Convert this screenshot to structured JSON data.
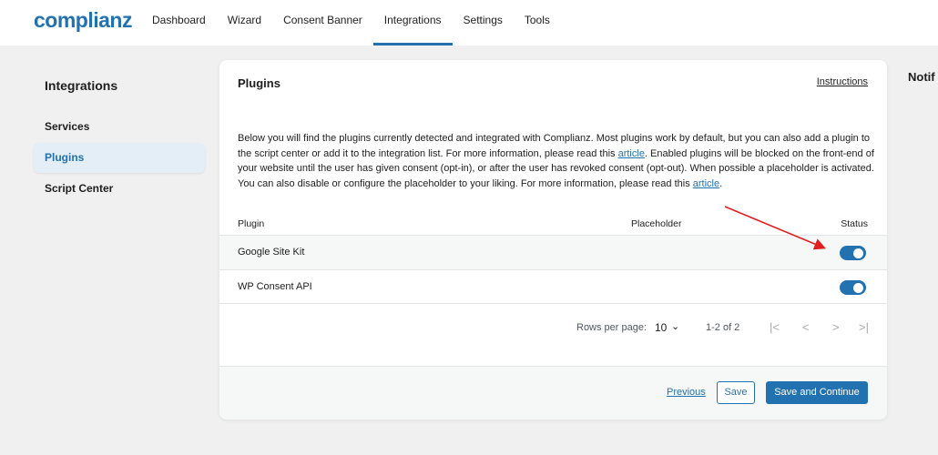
{
  "brand": {
    "logo": "complianz",
    "accent": "#2271b1"
  },
  "nav": [
    {
      "label": "Dashboard"
    },
    {
      "label": "Wizard"
    },
    {
      "label": "Consent Banner"
    },
    {
      "label": "Integrations",
      "active": true
    },
    {
      "label": "Settings"
    },
    {
      "label": "Tools"
    }
  ],
  "sidebar": {
    "title": "Integrations",
    "items": [
      {
        "label": "Services"
      },
      {
        "label": "Plugins",
        "active": true
      },
      {
        "label": "Script Center"
      }
    ]
  },
  "card": {
    "title": "Plugins",
    "instructions_link": "Instructions",
    "description": {
      "part1": "Below you will find the plugins currently detected and integrated with Complianz. Most plugins work by default, but you can also add a plugin to the script center or add it to the integration list. For more information, please read this ",
      "link1": "article",
      "part2": ". Enabled plugins will be blocked on the front-end of your website until the user has given consent (opt-in), or after the user has revoked consent (opt-out). When possible a placeholder is activated. You can also disable or configure the placeholder to your liking. For more information, please read this ",
      "link2": "article",
      "part3": "."
    },
    "table": {
      "headers": {
        "plugin": "Plugin",
        "placeholder": "Placeholder",
        "status": "Status"
      },
      "rows": [
        {
          "name": "Google Site Kit",
          "status_on": true
        },
        {
          "name": "WP Consent API",
          "status_on": true
        }
      ]
    },
    "pagination": {
      "rows_per_page_label": "Rows per page:",
      "rows_per_page_value": "10",
      "range": "1-2 of 2",
      "first_icon": "|<",
      "prev_icon": "<",
      "next_icon": ">",
      "last_icon": ">|"
    },
    "footer": {
      "previous": "Previous",
      "save": "Save",
      "save_continue": "Save and Continue"
    }
  },
  "notifications_title": "Notif",
  "annotation_arrow_color": "#e02020"
}
